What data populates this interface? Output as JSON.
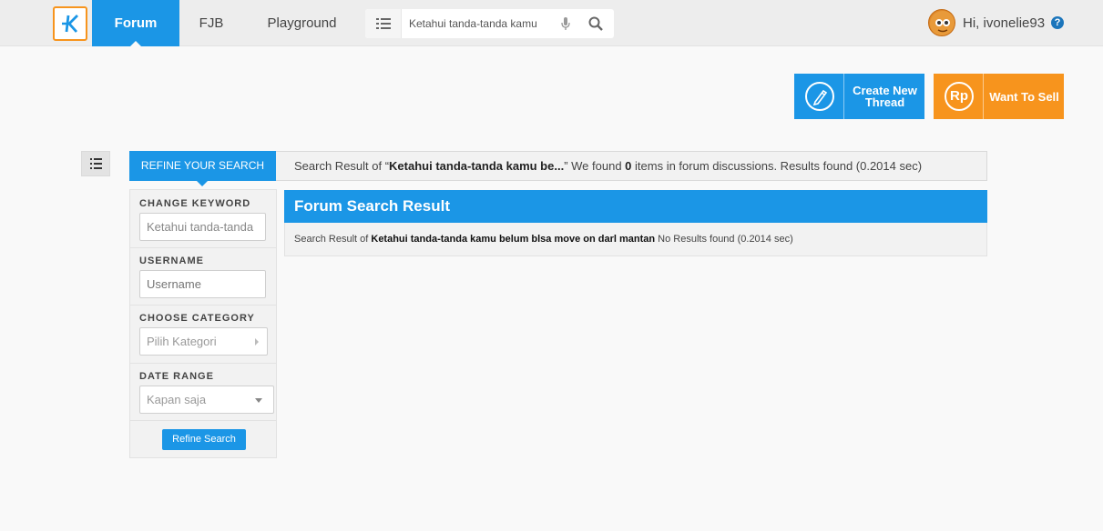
{
  "nav": {
    "tabs": [
      {
        "label": "Forum",
        "active": true
      },
      {
        "label": "FJB",
        "active": false
      },
      {
        "label": "Playground",
        "active": false
      }
    ],
    "search_value": "Ketahui tanda-tanda kamu",
    "greeting": "Hi, ivonelie93",
    "help": "?"
  },
  "actions": {
    "create_thread": "Create New Thread",
    "want_to_sell": "Want To Sell",
    "currency_icon": "Rp"
  },
  "result_bar": {
    "refine_tab": "REFINE YOUR SEARCH",
    "prefix": "Search Result of “",
    "query": "Ketahui tanda-tanda kamu be...",
    "middle": "” We found ",
    "count": "0",
    "suffix": " items in forum discussions. Results found (0.2014 sec)"
  },
  "refine": {
    "keyword_label": "CHANGE KEYWORD",
    "keyword_value": "Ketahui tanda-tanda",
    "username_label": "USERNAME",
    "username_placeholder": "Username",
    "category_label": "CHOOSE CATEGORY",
    "category_value": "Pilih Kategori",
    "date_label": "DATE RANGE",
    "date_value": "Kapan saja",
    "button": "Refine Search"
  },
  "forum_result": {
    "heading": "Forum Search Result",
    "prefix": "Search Result of ",
    "query": "Ketahui tanda-tanda kamu belum blsa move on darl mantan",
    "suffix": " No Results found (0.2014 sec)"
  },
  "colors": {
    "primary": "#1b96e6",
    "accent": "#f7941d"
  }
}
